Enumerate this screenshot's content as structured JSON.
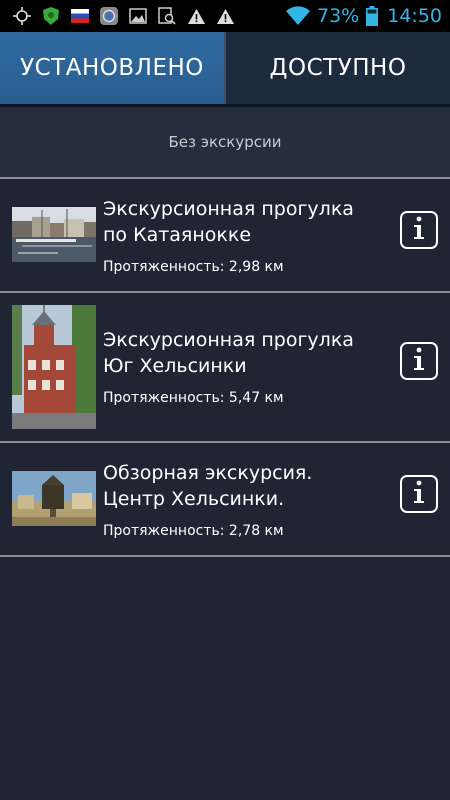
{
  "status_bar": {
    "battery_percent": "73%",
    "time": "14:50",
    "icons": [
      "gps-icon",
      "shield-app-icon",
      "russia-flag-icon",
      "camera-app-icon",
      "image-icon",
      "search-app-icon",
      "warning-icon",
      "warning-icon",
      "wifi-icon",
      "battery-icon"
    ],
    "accent_color": "#33b5e5"
  },
  "tabs": [
    {
      "label": "УСТАНОВЛЕНО",
      "active": true
    },
    {
      "label": "ДОСТУПНО",
      "active": false
    }
  ],
  "no_excursion": {
    "label": "Без экскурсии"
  },
  "tours": [
    {
      "title_line1": "Экскурсионная прогулка",
      "title_line2": "по Катаянокке",
      "length": "Протяженность: 2,98 км",
      "info_icon": "info-icon"
    },
    {
      "title_line1": "Экскурсионная прогулка",
      "title_line2": "Юг Хельсинки",
      "length": "Протяженность: 5,47 км",
      "info_icon": "info-icon"
    },
    {
      "title_line1": "Обзорная экскурсия.",
      "title_line2": "Центр Хельсинки.",
      "length": "Протяженность: 2,78 км",
      "info_icon": "info-icon"
    }
  ],
  "colors": {
    "background": "#1f2532",
    "active_tab": "#2e6aa0",
    "divider": "#8a909a"
  }
}
